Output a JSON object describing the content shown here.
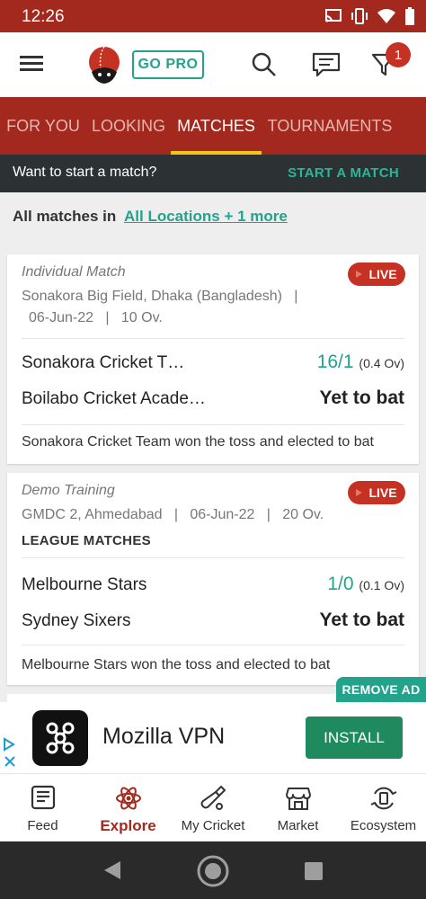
{
  "status": {
    "time": "12:26",
    "icons": [
      "cast-icon",
      "vibrate-icon",
      "wifi-icon",
      "battery-icon"
    ]
  },
  "header": {
    "pro_label": "GO PRO",
    "notification_count": "1",
    "icons": [
      "menu-icon",
      "cricket-ball-logo",
      "search-icon",
      "chat-icon",
      "filter-icon"
    ]
  },
  "tabs": [
    {
      "label": "FOR YOU",
      "active": false
    },
    {
      "label": "LOOKING",
      "active": false
    },
    {
      "label": "MATCHES",
      "active": true
    },
    {
      "label": "TOURNAMENTS",
      "active": false
    }
  ],
  "start_bar": {
    "question": "Want to start a match?",
    "action": "START A MATCH"
  },
  "filter": {
    "prefix": "All matches in",
    "location": "All Locations + 1 more"
  },
  "matches": [
    {
      "type": "Individual Match",
      "status": "LIVE",
      "venue_line": "Sonakora Big Field, Dhaka (Bangladesh)   |",
      "meta_line": "06-Jun-22   |   10 Ov.",
      "league": "",
      "team1": "Sonakora Cricket T…",
      "score1": "16/1",
      "overs1": "(0.4 Ov)",
      "team2": "Boilabo Cricket Acade…",
      "score2": "Yet to bat",
      "result": "Sonakora Cricket Team won the toss and elected to bat"
    },
    {
      "type": "Demo Training",
      "status": "LIVE",
      "venue_line": "GMDC 2, Ahmedabad   |   06-Jun-22   |   20 Ov.",
      "meta_line": "",
      "league": "LEAGUE MATCHES",
      "team1": "Melbourne Stars",
      "score1": "1/0",
      "overs1": "(0.1 Ov)",
      "team2": "Sydney Sixers",
      "score2": "Yet to bat",
      "result": "Melbourne Stars won the toss and elected to bat"
    }
  ],
  "ad": {
    "remove_label": "REMOVE AD",
    "title": "Mozilla VPN",
    "install_label": "INSTALL"
  },
  "bottom_nav": [
    {
      "label": "Feed",
      "icon": "feed-icon",
      "active": false
    },
    {
      "label": "Explore",
      "icon": "explore-icon",
      "active": true
    },
    {
      "label": "My Cricket",
      "icon": "cricket-bat-icon",
      "active": false
    },
    {
      "label": "Market",
      "icon": "market-icon",
      "active": false
    },
    {
      "label": "Ecosystem",
      "icon": "ecosystem-icon",
      "active": false
    }
  ],
  "colors": {
    "brand_red": "#a3281e",
    "accent_green": "#23a28c",
    "live_red": "#c53122",
    "tab_indicator": "#f3c518"
  }
}
